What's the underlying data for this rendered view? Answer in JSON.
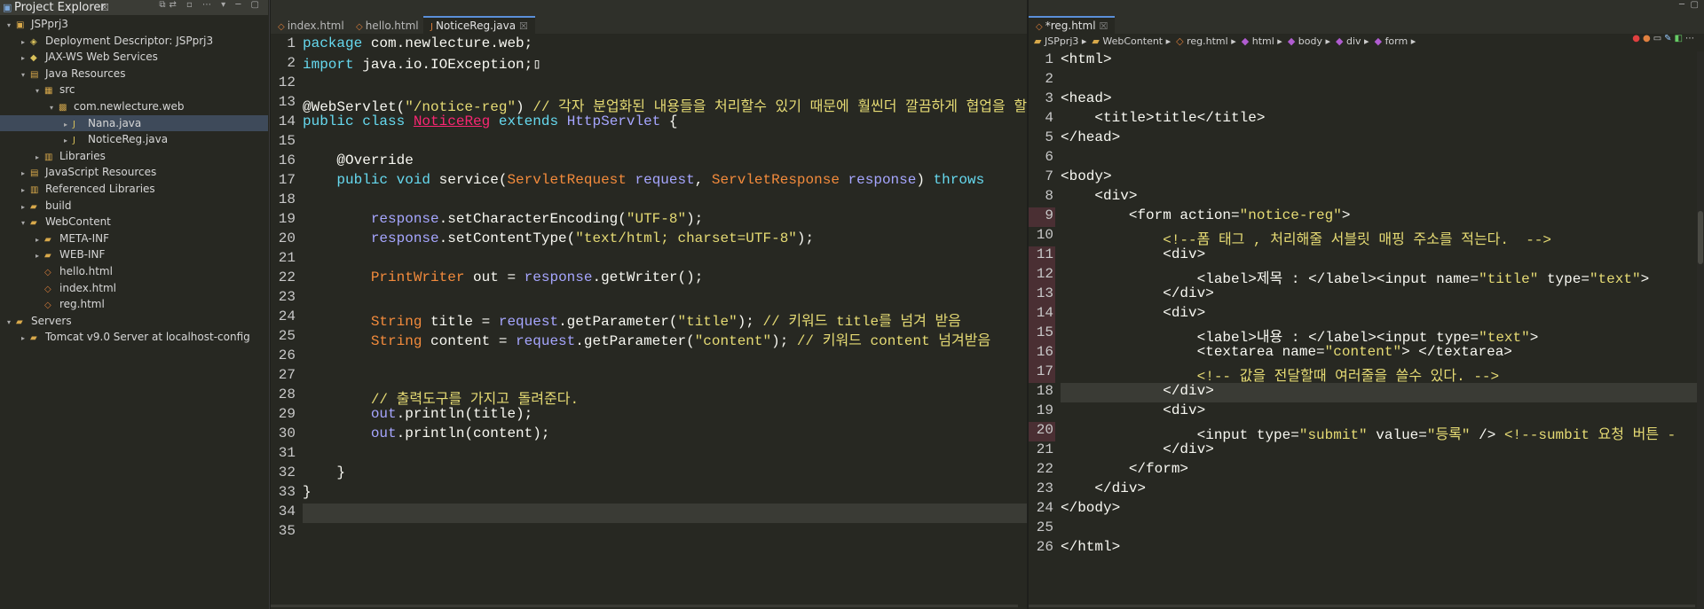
{
  "explorer": {
    "title": "Project Explorer",
    "title_suffix": "☒",
    "tree": [
      {
        "label": "JSPprj3",
        "icon": "project-icon",
        "depth": 0,
        "twisty": "▾"
      },
      {
        "label": "Deployment Descriptor: JSPprj3",
        "icon": "descriptor-icon",
        "depth": 1,
        "twisty": "▸"
      },
      {
        "label": "JAX-WS Web Services",
        "icon": "webservice-icon",
        "depth": 1,
        "twisty": "▸"
      },
      {
        "label": "Java Resources",
        "icon": "java-resources-icon",
        "depth": 1,
        "twisty": "▾"
      },
      {
        "label": "src",
        "icon": "src-folder-icon",
        "depth": 2,
        "twisty": "▾"
      },
      {
        "label": "com.newlecture.web",
        "icon": "package-icon",
        "depth": 3,
        "twisty": "▾"
      },
      {
        "label": "Nana.java",
        "icon": "java-file-icon",
        "depth": 4,
        "twisty": "▸",
        "selected": true
      },
      {
        "label": "NoticeReg.java",
        "icon": "java-file-icon",
        "depth": 4,
        "twisty": "▸"
      },
      {
        "label": "Libraries",
        "icon": "library-icon",
        "depth": 2,
        "twisty": "▸"
      },
      {
        "label": "JavaScript Resources",
        "icon": "js-resources-icon",
        "depth": 1,
        "twisty": "▸"
      },
      {
        "label": "Referenced Libraries",
        "icon": "library-icon",
        "depth": 1,
        "twisty": "▸"
      },
      {
        "label": "build",
        "icon": "folder-icon",
        "depth": 1,
        "twisty": "▸"
      },
      {
        "label": "WebContent",
        "icon": "folder-icon",
        "depth": 1,
        "twisty": "▾"
      },
      {
        "label": "META-INF",
        "icon": "folder-icon",
        "depth": 2,
        "twisty": "▸"
      },
      {
        "label": "WEB-INF",
        "icon": "folder-icon",
        "depth": 2,
        "twisty": "▸"
      },
      {
        "label": "hello.html",
        "icon": "html-file-icon",
        "depth": 2,
        "twisty": ""
      },
      {
        "label": "index.html",
        "icon": "html-file-icon",
        "depth": 2,
        "twisty": ""
      },
      {
        "label": "reg.html",
        "icon": "html-file-icon",
        "depth": 2,
        "twisty": ""
      },
      {
        "label": "Servers",
        "icon": "folder-icon",
        "depth": 0,
        "twisty": "▾"
      },
      {
        "label": "Tomcat v9.0 Server at localhost-config",
        "icon": "folder-icon",
        "depth": 1,
        "twisty": "▸"
      }
    ]
  },
  "java_editor": {
    "tabs": [
      {
        "label": "index.html",
        "active": false
      },
      {
        "label": "hello.html",
        "active": false
      },
      {
        "label": "NoticeReg.java",
        "active": true
      }
    ],
    "lines": [
      {
        "n": "1",
        "html": "<span class='kw'>package</span> com.newlecture.web;"
      },
      {
        "n": "2",
        "html": "<span class='kw'>import</span> java.io.IOException;▯"
      },
      {
        "n": "12",
        "html": ""
      },
      {
        "n": "13",
        "html": "@WebServlet(<span class='str'>\"/notice-reg\"</span>) <span class='cm'>// 각자 분업화된 내용들을 처리할수 있기 때문에 훨씬더 깔끔하게 협업을 할</span>"
      },
      {
        "n": "14",
        "html": "<span class='kw'>public class</span> <span class='err'>NoticeReg</span> <span class='kw'>extends</span> <span class='var'>HttpServlet</span> {"
      },
      {
        "n": "15",
        "html": ""
      },
      {
        "n": "16",
        "html": "    @Override"
      },
      {
        "n": "17",
        "html": "    <span class='kw'>public void</span> service(<span class='ty'>ServletRequest</span> <span class='var'>request</span>, <span class='ty'>ServletResponse</span> <span class='var'>response</span>) <span class='kw'>throws</span>"
      },
      {
        "n": "18",
        "html": ""
      },
      {
        "n": "19",
        "html": "        <span class='var'>response</span>.setCharacterEncoding(<span class='str'>\"UTF-8\"</span>);"
      },
      {
        "n": "20",
        "html": "        <span class='var'>response</span>.setContentType(<span class='str'>\"text/html; charset=UTF-8\"</span>);"
      },
      {
        "n": "21",
        "html": ""
      },
      {
        "n": "22",
        "html": "        <span class='ty'>PrintWriter</span> out = <span class='var'>response</span>.getWriter();"
      },
      {
        "n": "23",
        "html": ""
      },
      {
        "n": "24",
        "html": "        <span class='ty'>String</span> title = <span class='var'>request</span>.getParameter(<span class='str'>\"title\"</span>); <span class='cm'>// 키워드 title를 넘겨 받음</span>"
      },
      {
        "n": "25",
        "html": "        <span class='ty'>String</span> content = <span class='var'>request</span>.getParameter(<span class='str'>\"content\"</span>); <span class='cm'>// 키워드 content 넘겨받음</span>"
      },
      {
        "n": "26",
        "html": ""
      },
      {
        "n": "27",
        "html": ""
      },
      {
        "n": "28",
        "html": "        <span class='cm'>// 출력도구를 가지고 돌려준다.</span>"
      },
      {
        "n": "29",
        "html": "        <span class='var'>out</span>.println(title);"
      },
      {
        "n": "30",
        "html": "        <span class='var'>out</span>.println(content);"
      },
      {
        "n": "31",
        "html": ""
      },
      {
        "n": "32",
        "html": "    }"
      },
      {
        "n": "33",
        "html": "}"
      },
      {
        "n": "34",
        "html": ""
      },
      {
        "n": "35",
        "html": ""
      }
    ]
  },
  "html_editor": {
    "tabs": [
      {
        "label": "*reg.html",
        "active": true
      }
    ],
    "breadcrumb": [
      "JSPprj3",
      "WebContent",
      "reg.html",
      "html",
      "body",
      "div",
      "form"
    ],
    "lines": [
      {
        "n": "1",
        "html": "&lt;html&gt;"
      },
      {
        "n": "2",
        "html": ""
      },
      {
        "n": "3",
        "html": "&lt;head&gt;"
      },
      {
        "n": "4",
        "html": "    &lt;title&gt;title&lt;/title&gt;"
      },
      {
        "n": "5",
        "html": "&lt;/head&gt;"
      },
      {
        "n": "6",
        "html": ""
      },
      {
        "n": "7",
        "html": "&lt;body&gt;"
      },
      {
        "n": "8",
        "html": "    &lt;div&gt;"
      },
      {
        "n": "9",
        "html": "        &lt;form action=<span class='atv'>\"notice-reg\"</span>&gt;"
      },
      {
        "n": "10",
        "html": "            <span class='hcm'>&lt;!--폼 태그 , 처리해줄 서블릿 매핑 주소를 적는다.  --&gt;</span>"
      },
      {
        "n": "11",
        "html": "            &lt;div&gt;"
      },
      {
        "n": "12",
        "html": "                &lt;label&gt;제목 : &lt;/label&gt;&lt;input name=<span class='atv'>\"title\"</span> type=<span class='atv'>\"text\"</span>&gt;"
      },
      {
        "n": "13",
        "html": "            &lt;/div&gt;"
      },
      {
        "n": "14",
        "html": "            &lt;div&gt;"
      },
      {
        "n": "15",
        "html": "                &lt;label&gt;내용 : &lt;/label&gt;&lt;input type=<span class='atv'>\"text\"</span>&gt;"
      },
      {
        "n": "16",
        "html": "                &lt;textarea name=<span class='atv'>\"content\"</span>&gt; &lt;/textarea&gt;"
      },
      {
        "n": "17",
        "html": "                <span class='hcm'>&lt;!-- 값을 전달할때 여러줄을 쓸수 있다. --&gt;</span>"
      },
      {
        "n": "18",
        "html": "            &lt;/div&gt;"
      },
      {
        "n": "19",
        "html": "            &lt;div&gt;"
      },
      {
        "n": "20",
        "html": "                &lt;input type=<span class='atv'>\"submit\"</span> value=<span class='atv'>\"등록\"</span> /&gt; <span class='hcm'>&lt;!--sumbit 요청 버튼 -</span>"
      },
      {
        "n": "21",
        "html": "            &lt;/div&gt;"
      },
      {
        "n": "22",
        "html": "        &lt;/form&gt;"
      },
      {
        "n": "23",
        "html": "    &lt;/div&gt;"
      },
      {
        "n": "24",
        "html": "&lt;/body&gt;"
      },
      {
        "n": "25",
        "html": ""
      },
      {
        "n": "26",
        "html": "&lt;/html&gt;"
      }
    ]
  }
}
